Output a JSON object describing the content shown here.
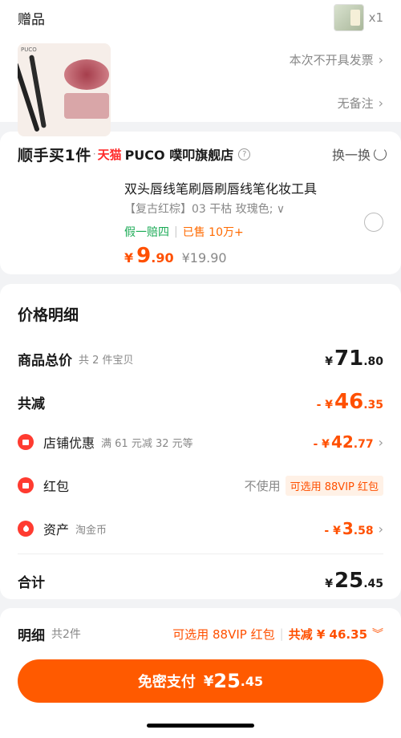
{
  "gift": {
    "label": "赠品",
    "qty": "x1"
  },
  "invoice": {
    "label": "发票",
    "value": "本次不开具发票"
  },
  "remark": {
    "label": "备注",
    "value": "无备注"
  },
  "store": {
    "brand": "顺手买1件",
    "tmall": "天猫",
    "name": "PUCO 噗叩旗舰店",
    "swap": "换一换"
  },
  "product": {
    "title": "双头唇线笔刷唇刷唇线笔化妆工具",
    "sku": "【复古红棕】03 干枯 玫瑰色; ∨",
    "guarantee": "假一赔四",
    "sold": "已售 10万+",
    "price_yen": "¥",
    "price_int": "9",
    "price_dec": ".90",
    "orig_price": "¥19.90"
  },
  "price_detail": {
    "title": "价格明细",
    "total": {
      "label": "商品总价",
      "sub": "共 2 件宝贝",
      "yen": "¥",
      "int": "71",
      "dec": ".80"
    },
    "reduce": {
      "label": "共减",
      "yen": "- ¥",
      "int": "46",
      "dec": ".35"
    },
    "store_discount": {
      "label": "店铺优惠",
      "sub": "满 61 元减 32 元等",
      "yen": "- ¥",
      "int": "42",
      "dec": ".77"
    },
    "red_packet": {
      "label": "红包",
      "value": "不使用",
      "chip": "可选用 88VIP 红包"
    },
    "assets": {
      "label": "资产",
      "sub": "淘金币",
      "yen": "- ¥",
      "int": "3",
      "dec": ".58"
    },
    "sum": {
      "label": "合计",
      "yen": "¥",
      "int": "25",
      "dec": ".45"
    }
  },
  "bottom": {
    "detail_label": "明细",
    "detail_sub": "共2件",
    "vip": "可选用 88VIP 红包",
    "reduce": "共减 ¥ 46.35",
    "pay_label": "免密支付",
    "pay_yen": "¥",
    "pay_int": "25",
    "pay_dec": ".45"
  },
  "colors": {
    "accent": "#ff5000",
    "pay_button": "#ff5a00",
    "green": "#1aaa55",
    "red_icon": "#ff3b30"
  }
}
